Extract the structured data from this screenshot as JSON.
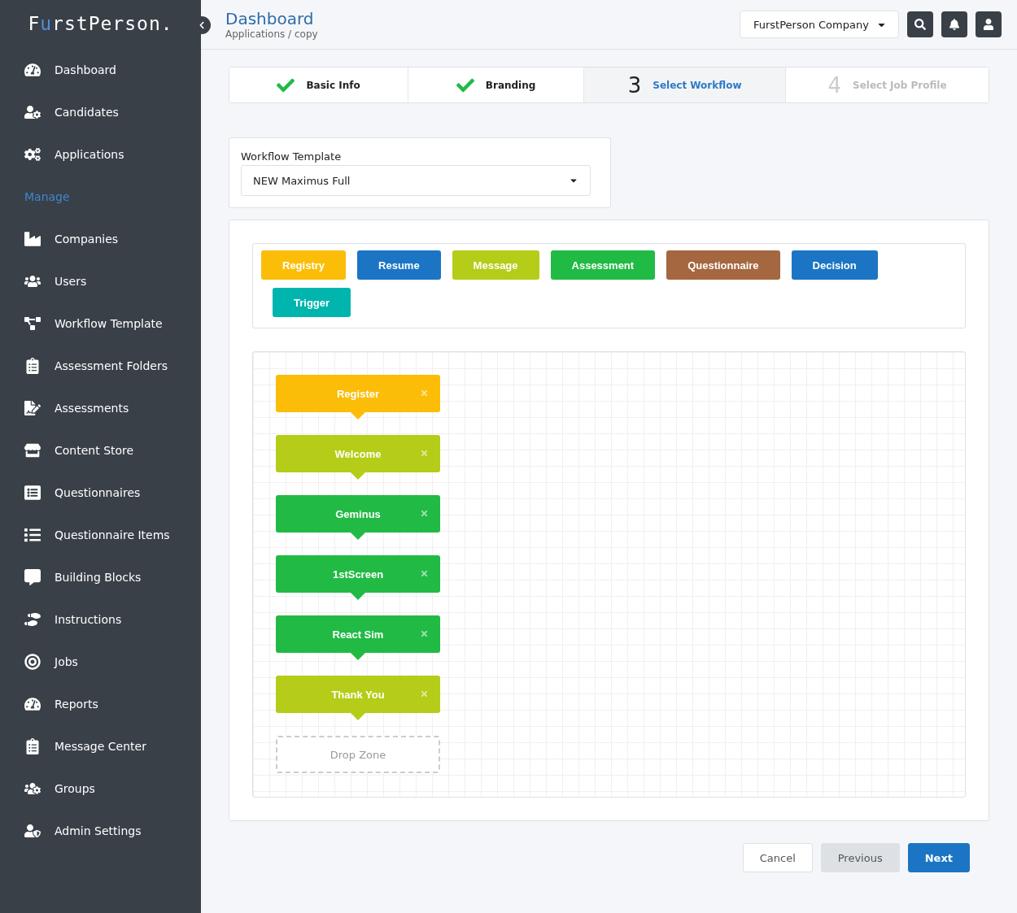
{
  "sidebar": {
    "logo": [
      {
        "text": "F",
        "accent": false
      },
      {
        "text": "u",
        "accent": true
      },
      {
        "text": "rstPerson.",
        "accent": false
      }
    ],
    "items": [
      {
        "kind": "link",
        "label": "Dashboard"
      },
      {
        "kind": "link",
        "label": "Candidates"
      },
      {
        "kind": "link",
        "label": "Applications"
      },
      {
        "kind": "heading",
        "label": "Manage"
      },
      {
        "kind": "link",
        "label": "Companies"
      },
      {
        "kind": "link",
        "label": "Users"
      },
      {
        "kind": "link",
        "label": "Workflow Template"
      },
      {
        "kind": "link",
        "label": "Assessment Folders"
      },
      {
        "kind": "link",
        "label": "Assessments"
      },
      {
        "kind": "link",
        "label": "Content Store"
      },
      {
        "kind": "link",
        "label": "Questionnaires"
      },
      {
        "kind": "link",
        "label": "Questionnaire Items"
      },
      {
        "kind": "link",
        "label": "Building Blocks"
      },
      {
        "kind": "link",
        "label": "Instructions"
      },
      {
        "kind": "link",
        "label": "Jobs"
      },
      {
        "kind": "link",
        "label": "Reports"
      },
      {
        "kind": "link",
        "label": "Message Center"
      },
      {
        "kind": "link",
        "label": "Groups"
      },
      {
        "kind": "link",
        "label": "Admin Settings"
      }
    ]
  },
  "header": {
    "title": "Dashboard",
    "breadcrumb": [
      "Applications",
      "copy"
    ],
    "breadcrumb_separator": "/",
    "company": "FurstPerson Company"
  },
  "steps": [
    {
      "label": "Basic Info",
      "kind": "done"
    },
    {
      "label": "Branding",
      "kind": "done"
    },
    {
      "number": "3",
      "label": "Select Workflow",
      "kind": "current"
    },
    {
      "number": "4",
      "label": "Select Job Profile",
      "kind": "pending"
    }
  ],
  "template": {
    "label": "Workflow Template",
    "value": "NEW Maximus Full"
  },
  "palette": [
    {
      "label": "Registry",
      "color": "#fbbd08"
    },
    {
      "label": "Resume",
      "color": "#1b75c4"
    },
    {
      "label": "Message",
      "color": "#b5cc18"
    },
    {
      "label": "Assessment",
      "color": "#21ba45"
    },
    {
      "label": "Questionnaire",
      "color": "#a5673f"
    },
    {
      "label": "Decision",
      "color": "#1b75c4"
    },
    {
      "label": "Trigger",
      "color": "#00b5ad"
    }
  ],
  "workflow": [
    {
      "label": "Register",
      "color": "#fbbd08"
    },
    {
      "label": "Welcome",
      "color": "#b5cc18"
    },
    {
      "label": "Geminus",
      "color": "#21ba45"
    },
    {
      "label": "1stScreen",
      "color": "#21ba45"
    },
    {
      "label": "React Sim",
      "color": "#21ba45"
    },
    {
      "label": "Thank You",
      "color": "#b5cc18"
    }
  ],
  "drop_zone": "Drop Zone",
  "buttons": [
    {
      "label": "Cancel",
      "kind": "default"
    },
    {
      "label": "Previous",
      "kind": "disabled"
    },
    {
      "label": "Next",
      "kind": "primary"
    }
  ]
}
